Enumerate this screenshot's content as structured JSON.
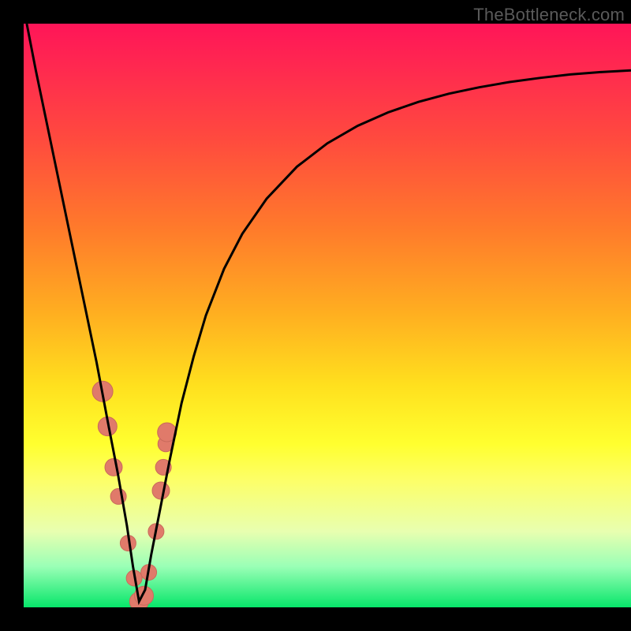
{
  "watermark": "TheBottleneck.com",
  "colors": {
    "frame": "#000000",
    "curve": "#000000",
    "marker_fill": "#e07a6a",
    "marker_stroke": "#c96a5b",
    "gradient_top": "#ff1558",
    "gradient_bottom": "#07e66a"
  },
  "chart_data": {
    "type": "line",
    "title": "",
    "xlabel": "",
    "ylabel": "",
    "xlim": [
      0,
      100
    ],
    "ylim": [
      0,
      100
    ],
    "note": "No numeric axis ticks are shown. x is a normalized horizontal position (0–100); y is a normalized vertical value (0=bottom/green, 100=top/red). Curve reaches its minimum near x≈19.",
    "series": [
      {
        "name": "bottleneck-curve",
        "x": [
          0.5,
          2,
          4,
          6,
          8,
          10,
          12,
          14,
          15.5,
          17,
          18,
          19,
          20,
          21,
          22.5,
          24,
          26,
          28,
          30,
          33,
          36,
          40,
          45,
          50,
          55,
          60,
          65,
          70,
          75,
          80,
          85,
          90,
          95,
          100
        ],
        "y": [
          100,
          92,
          82,
          72,
          62,
          52,
          42,
          31,
          23,
          14,
          7,
          1,
          3,
          9,
          17,
          25,
          35,
          43,
          50,
          58,
          64,
          70,
          75.5,
          79.5,
          82.5,
          84.8,
          86.6,
          88,
          89.1,
          90,
          90.7,
          91.3,
          91.7,
          92
        ]
      }
    ],
    "markers": {
      "name": "sample-points",
      "x": [
        13.0,
        13.8,
        14.8,
        15.6,
        17.2,
        18.2,
        19.0,
        19.8,
        20.6,
        21.8,
        22.6,
        23.0,
        23.4,
        23.6
      ],
      "y": [
        37,
        31,
        24,
        19,
        11,
        5,
        1,
        2,
        6,
        13,
        20,
        24,
        28,
        30
      ],
      "r": [
        13,
        12,
        11,
        10,
        10,
        10,
        12,
        12,
        10,
        10,
        11,
        10,
        10,
        12
      ]
    }
  }
}
